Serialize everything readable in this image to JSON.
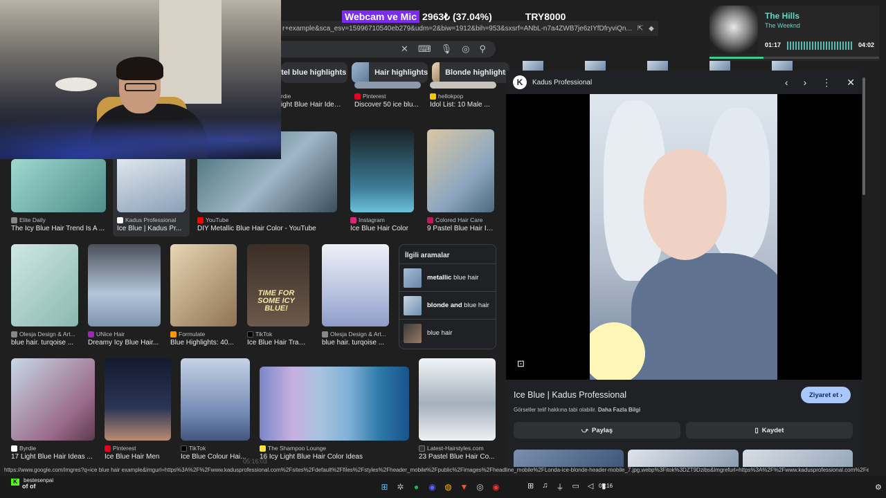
{
  "overlay": {
    "badge": "Webcam ve Mic",
    "progress": "2963₺ (37.04%)",
    "target": "TRY8000"
  },
  "browser": {
    "url": "r+example&sca_esv=15996710540eb279&udm=2&biw=1912&bih=953&sxsrf=ANbL-n7a4ZWB7je6zIYfDfryviQn...",
    "search_clear": "✕"
  },
  "chips": [
    {
      "label": "stel blue highlights"
    },
    {
      "label": "Hair highlights"
    },
    {
      "label": "Blonde highlights"
    }
  ],
  "results": [
    {
      "source": "rdie",
      "title": "ight Blue Hair Idea..."
    },
    {
      "source": "Pinterest",
      "title": "Discover 50 ice blu..."
    },
    {
      "source": "hellokpop",
      "title": "Idol List: 10 Male ..."
    },
    {
      "source": "Elite Daily",
      "title": "The Icy Blue Hair Trend Is A ..."
    },
    {
      "source": "Kadus Professional",
      "title": "Ice Blue | Kadus Pr..."
    },
    {
      "source": "YouTube",
      "title": "DIY Metallic Blue Hair Color - YouTube"
    },
    {
      "source": "Instagram",
      "title": "Ice Blue Hair Color"
    },
    {
      "source": "Colored Hair Care",
      "title": "9 Pastel Blue Hair Id..."
    },
    {
      "source": "Olesja Design & Art...",
      "title": "blue hair. turqoise ..."
    },
    {
      "source": "UNice Hair",
      "title": "Dreamy Icy Blue Hair..."
    },
    {
      "source": "Formulate",
      "title": "Blue Highlights: 40..."
    },
    {
      "source": "TikTok",
      "title": "Ice Blue Hair Trans..."
    },
    {
      "source": "Olesja Design & Art...",
      "title": "blue hair. turqoise ..."
    },
    {
      "source": "Byrdie",
      "title": "17 Light Blue Hair Ideas ..."
    },
    {
      "source": "Pinterest",
      "title": "Ice Blue Hair Men"
    },
    {
      "source": "TikTok",
      "title": "Ice Blue Colour Hai..."
    },
    {
      "source": "The Shampoo Lounge",
      "title": "16 Icy Light Blue Hair Color Ideas"
    },
    {
      "source": "Latest-Hairstyles.com",
      "title": "23 Pastel Blue Hair Co..."
    }
  ],
  "tiktok_caption": "TIME FOR SOME ICY BLUE!",
  "related": {
    "heading": "İlgili aramalar",
    "items": [
      {
        "bold": "metallic",
        "rest": " blue hair"
      },
      {
        "bold": "blonde and",
        "rest": " blue hair"
      },
      {
        "bold": "",
        "rest": "blue hair"
      }
    ]
  },
  "music": {
    "song": "The Hills",
    "artist": "The Weeknd",
    "elapsed": "01:17",
    "total": "04:02",
    "progress": 0.32
  },
  "panel": {
    "logo_letter": "K",
    "site": "Kadus Professional",
    "title": "Ice Blue | Kadus Professional",
    "visit_label": "Ziyaret et",
    "copyright": "Görseller telif hakkına tabi olabilir.",
    "more_info": "Daha Fazla Bilgi",
    "share_label": "Paylaş",
    "save_label": "Kaydet"
  },
  "status_url": "https://www.google.com/imgres?q=ice blue hair example&imgurl=https%3A%2F%2Fwww.kadusprofessional.com%2Fsites%2Fdefault%2Ffiles%2Fstyles%2Fheader_mobile%2Fpublic%2Fimages%2Fheadline_mobile%2FLonda-ice-blonde-header-mobile_7.jpg.webp%3Fitok%3DZT9Dzibs&imgrefurl=https%3A%2F%2Fwww.kadusprofessional.com%2Fen-a...",
  "taskbar": {
    "user": "bestesenpai",
    "chat": "of of",
    "timer": "05:16:03",
    "clock": "05:16"
  },
  "colors": {
    "accent": "#a8c7fa",
    "badge": "#7b2cf0",
    "music": "#5ed9c9"
  }
}
